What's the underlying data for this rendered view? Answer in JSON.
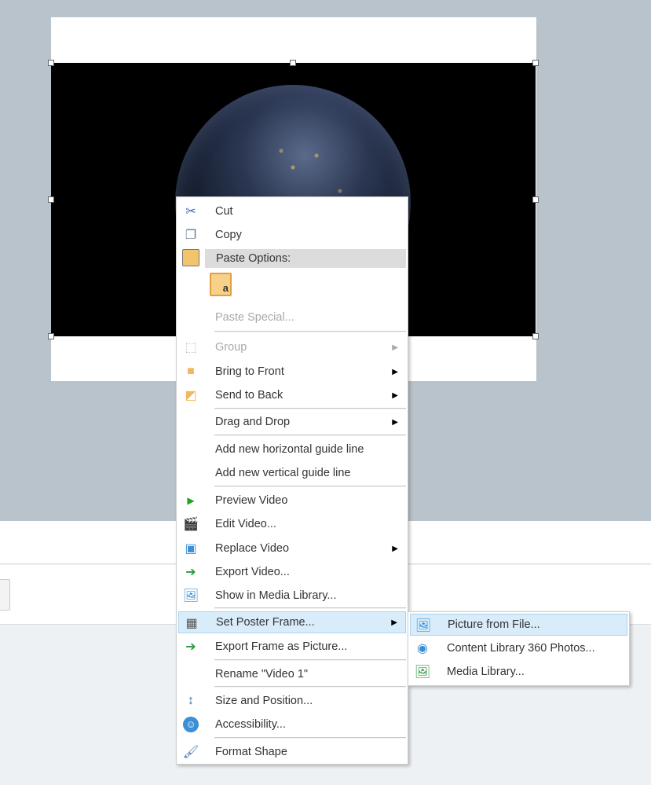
{
  "menu": {
    "cut": "Cut",
    "copy": "Copy",
    "paste_options": "Paste Options:",
    "paste_special": "Paste Special...",
    "group": "Group",
    "bring_front": "Bring to Front",
    "send_back": "Send to Back",
    "drag_drop": "Drag and Drop",
    "add_h_guide": "Add new horizontal guide line",
    "add_v_guide": "Add new vertical guide line",
    "preview_video": "Preview Video",
    "edit_video": "Edit Video...",
    "replace_video": "Replace Video",
    "export_video": "Export Video...",
    "show_media": "Show in Media Library...",
    "set_poster": "Set Poster Frame...",
    "export_frame": "Export Frame as Picture...",
    "rename": "Rename \"Video 1\"",
    "size_position": "Size and Position...",
    "accessibility": "Accessibility...",
    "format_shape": "Format Shape"
  },
  "submenu": {
    "picture_file": "Picture from File...",
    "content_360": "Content Library 360 Photos...",
    "media_library": "Media Library..."
  },
  "colors": {
    "canvas": "#b9c3cb",
    "highlight": "#d9ecf9",
    "accent": "#3a8fd6"
  }
}
